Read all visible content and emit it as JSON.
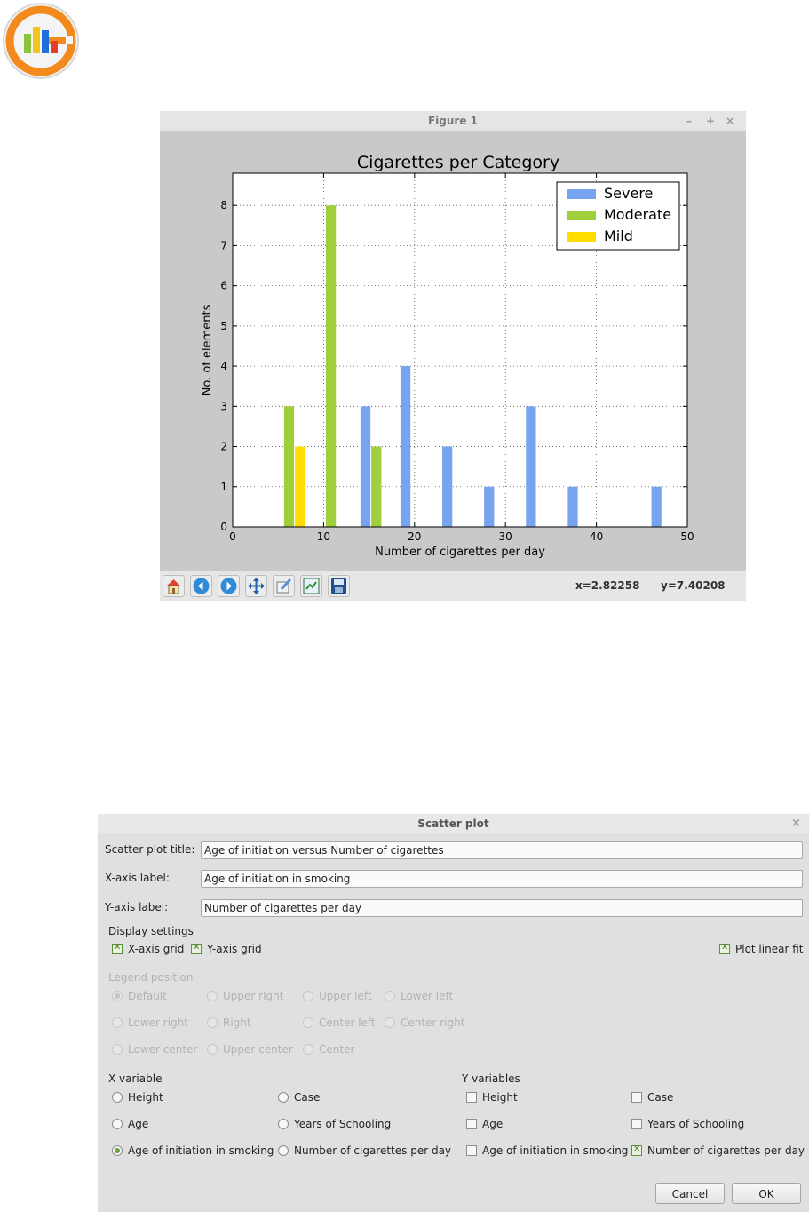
{
  "logo": {
    "icon": "chart-logo-icon",
    "colors": {
      "ring": "#f28a1e",
      "bar1": "#8ac43f",
      "bar2": "#1e6fd9",
      "bar3": "#e63a2e"
    }
  },
  "figure_window": {
    "title": "Figure 1",
    "controls": {
      "minimize": "–",
      "maximize": "+",
      "close": "×"
    },
    "toolbar": [
      {
        "name": "home",
        "icon": "home-icon"
      },
      {
        "name": "back",
        "icon": "back-arrow-icon"
      },
      {
        "name": "forward",
        "icon": "forward-arrow-icon"
      },
      {
        "name": "pan",
        "icon": "pan-arrows-icon"
      },
      {
        "name": "zoom",
        "icon": "zoom-rect-icon"
      },
      {
        "name": "subplots",
        "icon": "subplots-config-icon"
      },
      {
        "name": "save",
        "icon": "save-disk-icon"
      }
    ],
    "coords": {
      "x": "x=2.82258",
      "y": "y=7.40208"
    }
  },
  "chart_data": {
    "type": "bar",
    "title": "Cigarettes per Category",
    "xlabel": "Number of cigarettes per day",
    "ylabel": "No. of elements",
    "xlim": [
      0,
      50
    ],
    "ylim": [
      0,
      8.8
    ],
    "xticks": [
      0,
      10,
      20,
      30,
      40,
      50
    ],
    "yticks": [
      0,
      1,
      2,
      3,
      4,
      5,
      6,
      7,
      8
    ],
    "grid": true,
    "legend_position": "top-right",
    "bar_width": 1.1,
    "series": [
      {
        "name": "Severe",
        "color": "#77a4ef",
        "points": [
          {
            "x": 14.6,
            "y": 3
          },
          {
            "x": 19.0,
            "y": 4
          },
          {
            "x": 23.6,
            "y": 2
          },
          {
            "x": 28.2,
            "y": 1
          },
          {
            "x": 32.8,
            "y": 3
          },
          {
            "x": 37.4,
            "y": 1
          },
          {
            "x": 46.6,
            "y": 1
          }
        ]
      },
      {
        "name": "Moderate",
        "color": "#9fcf3a",
        "points": [
          {
            "x": 6.2,
            "y": 3
          },
          {
            "x": 10.8,
            "y": 8
          },
          {
            "x": 15.8,
            "y": 2
          }
        ]
      },
      {
        "name": "Mild",
        "color": "#ffdd00",
        "points": [
          {
            "x": 7.4,
            "y": 2
          }
        ]
      }
    ]
  },
  "scatter_dialog": {
    "title": "Scatter plot",
    "close": "×",
    "title_label": "Scatter plot title:",
    "title_value": "Age of initiation versus Number of cigarettes",
    "xlabel_label": "X-axis label:",
    "xlabel_value": "Age of initiation in smoking",
    "ylabel_label": "Y-axis label:",
    "ylabel_value": "Number of cigarettes per day",
    "display_settings": {
      "heading": "Display settings",
      "xgrid": {
        "label": "X-axis grid",
        "checked": true
      },
      "ygrid": {
        "label": "Y-axis grid",
        "checked": true
      },
      "linear_fit": {
        "label": "Plot linear fit",
        "checked": true
      }
    },
    "legend_position": {
      "heading": "Legend position",
      "options": [
        "Default",
        "Upper right",
        "Upper left",
        "Lower left",
        "Lower right",
        "Right",
        "Center left",
        "Center right",
        "Lower center",
        "Upper center",
        "Center"
      ],
      "selected": "Default"
    },
    "x_variable": {
      "heading": "X variable",
      "options": [
        "Height",
        "Case",
        "Age",
        "Years of Schooling",
        "Age of initiation in smoking",
        "Number of cigarettes per day"
      ],
      "selected": "Age of initiation in smoking"
    },
    "y_variables": {
      "heading": "Y variables",
      "options": [
        "Height",
        "Case",
        "Age",
        "Years of Schooling",
        "Age of initiation in smoking",
        "Number of cigarettes per day"
      ],
      "checked": [
        "Number of cigarettes per day"
      ]
    },
    "buttons": {
      "cancel": "Cancel",
      "ok": "OK"
    }
  }
}
